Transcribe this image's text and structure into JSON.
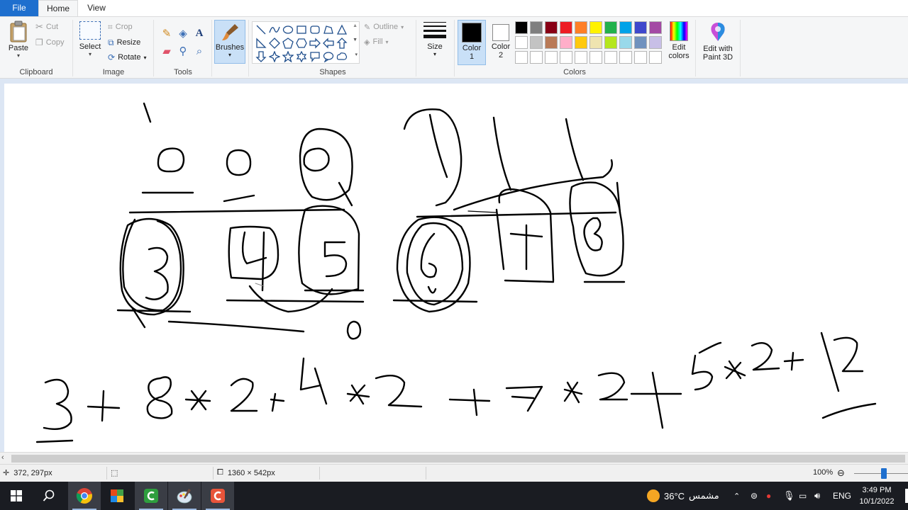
{
  "menu": {
    "file": "File",
    "home": "Home",
    "view": "View"
  },
  "clipboard": {
    "paste": "Paste",
    "cut": "Cut",
    "copy": "Copy",
    "label": "Clipboard"
  },
  "image": {
    "select": "Select",
    "crop": "Crop",
    "resize": "Resize",
    "rotate": "Rotate",
    "label": "Image"
  },
  "tools": {
    "label": "Tools",
    "text_tool": "A"
  },
  "brushes": {
    "label": "Brushes"
  },
  "shapes": {
    "outline": "Outline",
    "fill": "Fill",
    "label": "Shapes"
  },
  "size": {
    "label": "Size"
  },
  "colors": {
    "color1": "Color 1",
    "color2": "Color 2",
    "edit_colors": "Edit colors",
    "edit_paint3d": "Edit with Paint 3D",
    "label": "Colors",
    "color1_value": "#000000",
    "color2_value": "#ffffff",
    "palette_row1": [
      "#000000",
      "#7f7f7f",
      "#880015",
      "#ed1c24",
      "#ff7f27",
      "#fff200",
      "#22b14c",
      "#00a2e8",
      "#3f48cc",
      "#a349a4"
    ],
    "palette_row2": [
      "#ffffff",
      "#c3c3c3",
      "#b97a57",
      "#ffaec9",
      "#ffc90e",
      "#efe4b0",
      "#b5e61d",
      "#99d9ea",
      "#7092be",
      "#c8bfe7"
    ],
    "palette_row3": [
      "#ffffff",
      "#ffffff",
      "#ffffff",
      "#ffffff",
      "#ffffff",
      "#ffffff",
      "#ffffff",
      "#ffffff",
      "#ffffff",
      "#ffffff"
    ]
  },
  "status": {
    "cursor_pos": "372, 297px",
    "selection_size": "",
    "image_size": "1360 × 542px",
    "zoom": "100%"
  },
  "taskbar": {
    "weather_temp": "36°C",
    "weather_desc": "مشمس",
    "language": "ENG",
    "time": "3:49 PM",
    "date": "10/1/2022"
  }
}
